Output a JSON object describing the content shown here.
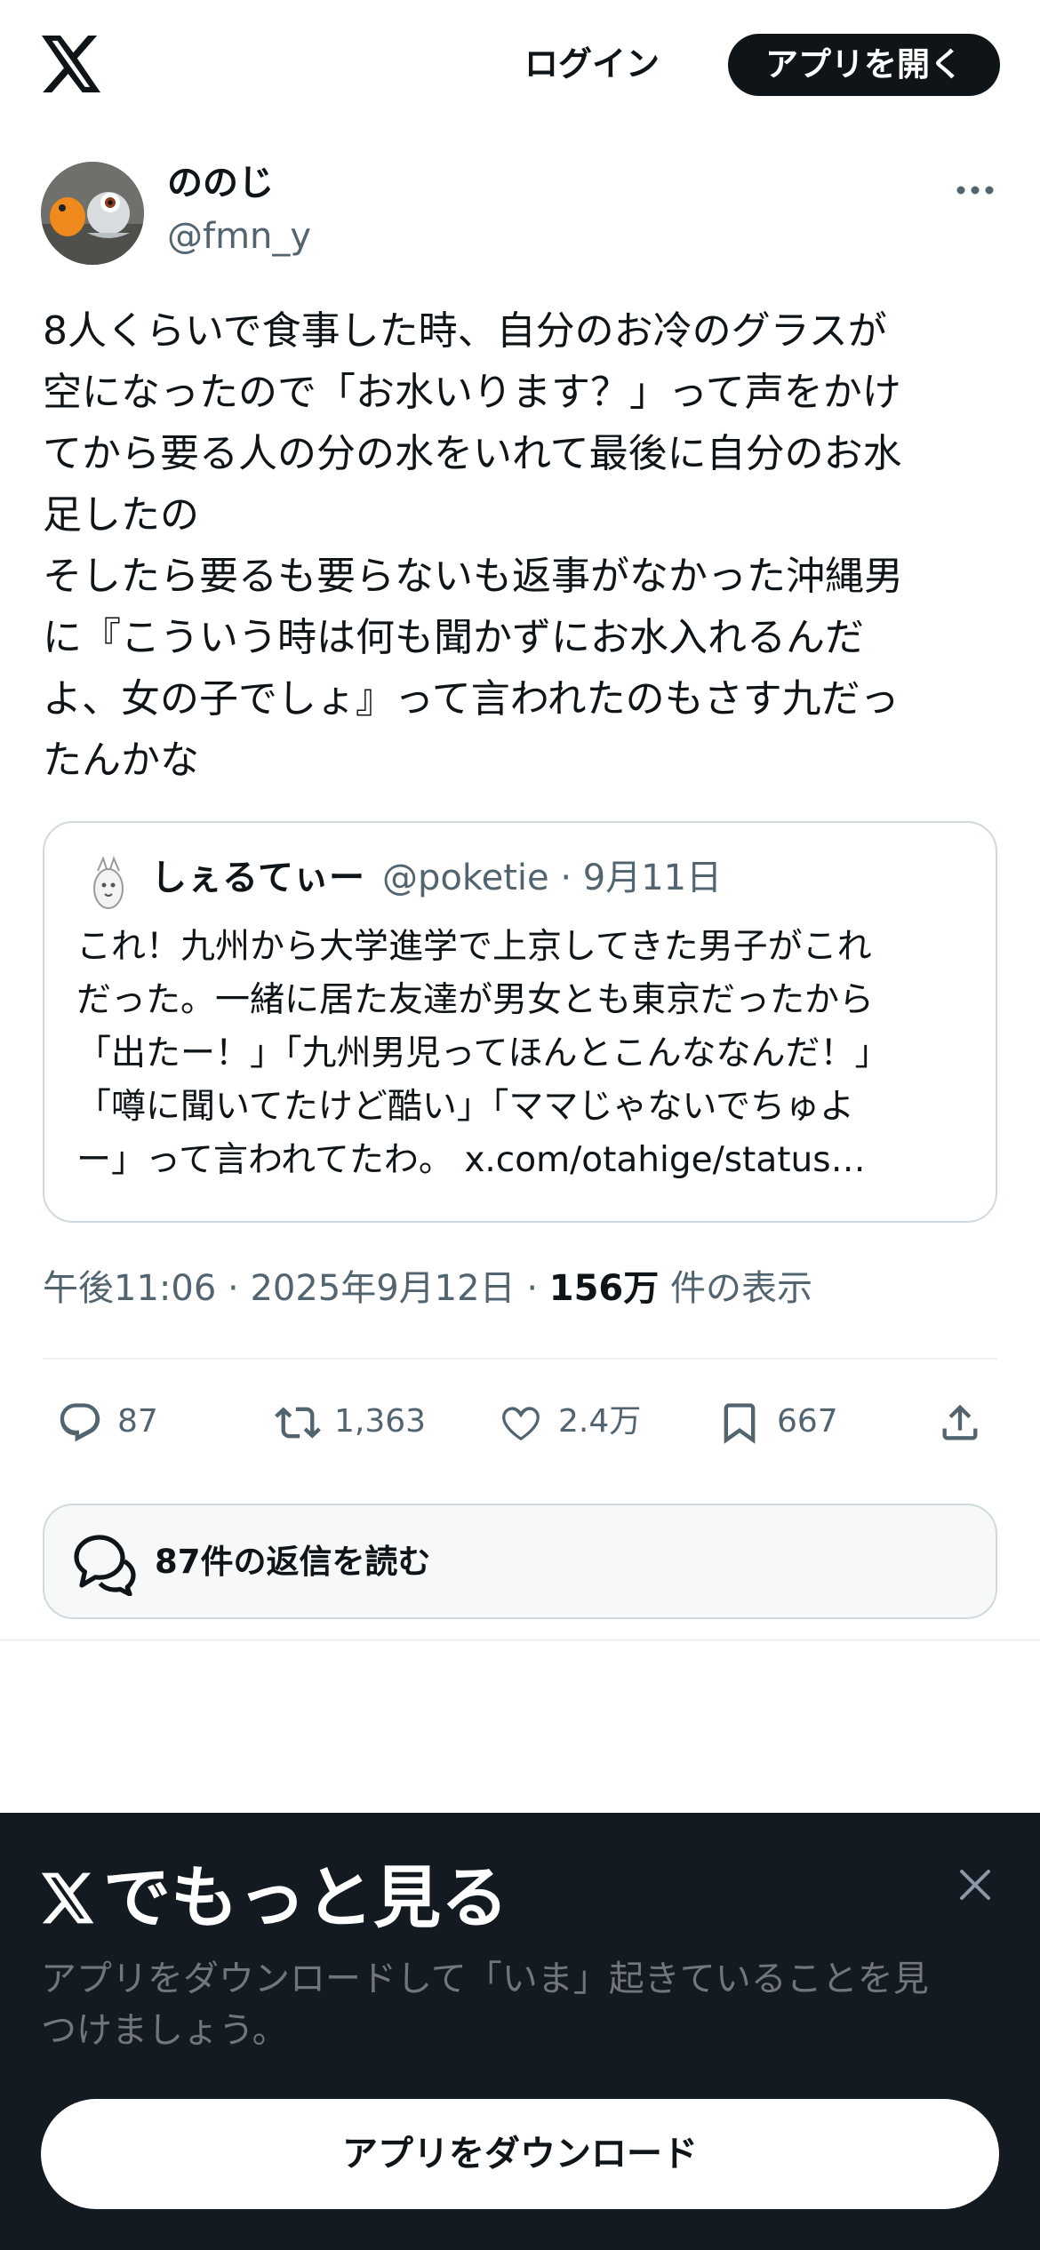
{
  "header": {
    "login_label": "ログイン",
    "open_app_label": "アプリを開く"
  },
  "author": {
    "name": "ののじ",
    "handle": "@fmn_y"
  },
  "tweet": {
    "text": "8人くらいで食事した時、自分のお冷のグラスが\n空になったので「お水いります？」って声をかけ\nてから要る人の分の水をいれて最後に自分のお水\n足したの\nそしたら要るも要らないも返事がなかった沖縄男\nに『こういう時は何も聞かずにお水入れるんだ\nよ、女の子でしょ』って言われたのもさす九だっ\nたんかな",
    "time": "午後11:06",
    "date": "2025年9月12日",
    "views_count": "156万",
    "views_label": "件の表示",
    "separator": "·"
  },
  "quote": {
    "name": "しぇるてぃー",
    "handle": "@poketie",
    "date": "9月11日",
    "meta": "@poketie · 9月11日",
    "text": "これ！九州から大学進学で上京してきた男子がこれ\nだった。一緒に居た友達が男女とも東京だったから\n「出たー！」「九州男児ってほんとこんななんだ！」\n「噂に聞いてたけど酷い」「ママじゃないでちゅよ\nー」って言われてたわ。 x.com/otahige/status…"
  },
  "actions": {
    "replies": "87",
    "reposts": "1,363",
    "likes": "2.4万",
    "bookmarks": "667"
  },
  "replies_button": {
    "label": "87件の返信を読む"
  },
  "sheet": {
    "title": "でもっと見る",
    "subtitle": "アプリをダウンロードして「いま」起きていることを見\nつけましょう。",
    "download_label": "アプリをダウンロード"
  },
  "colors": {
    "text_primary": "#0f1419",
    "text_secondary": "#536471",
    "border": "#cfd9de",
    "sheet_bg": "#141a21"
  }
}
